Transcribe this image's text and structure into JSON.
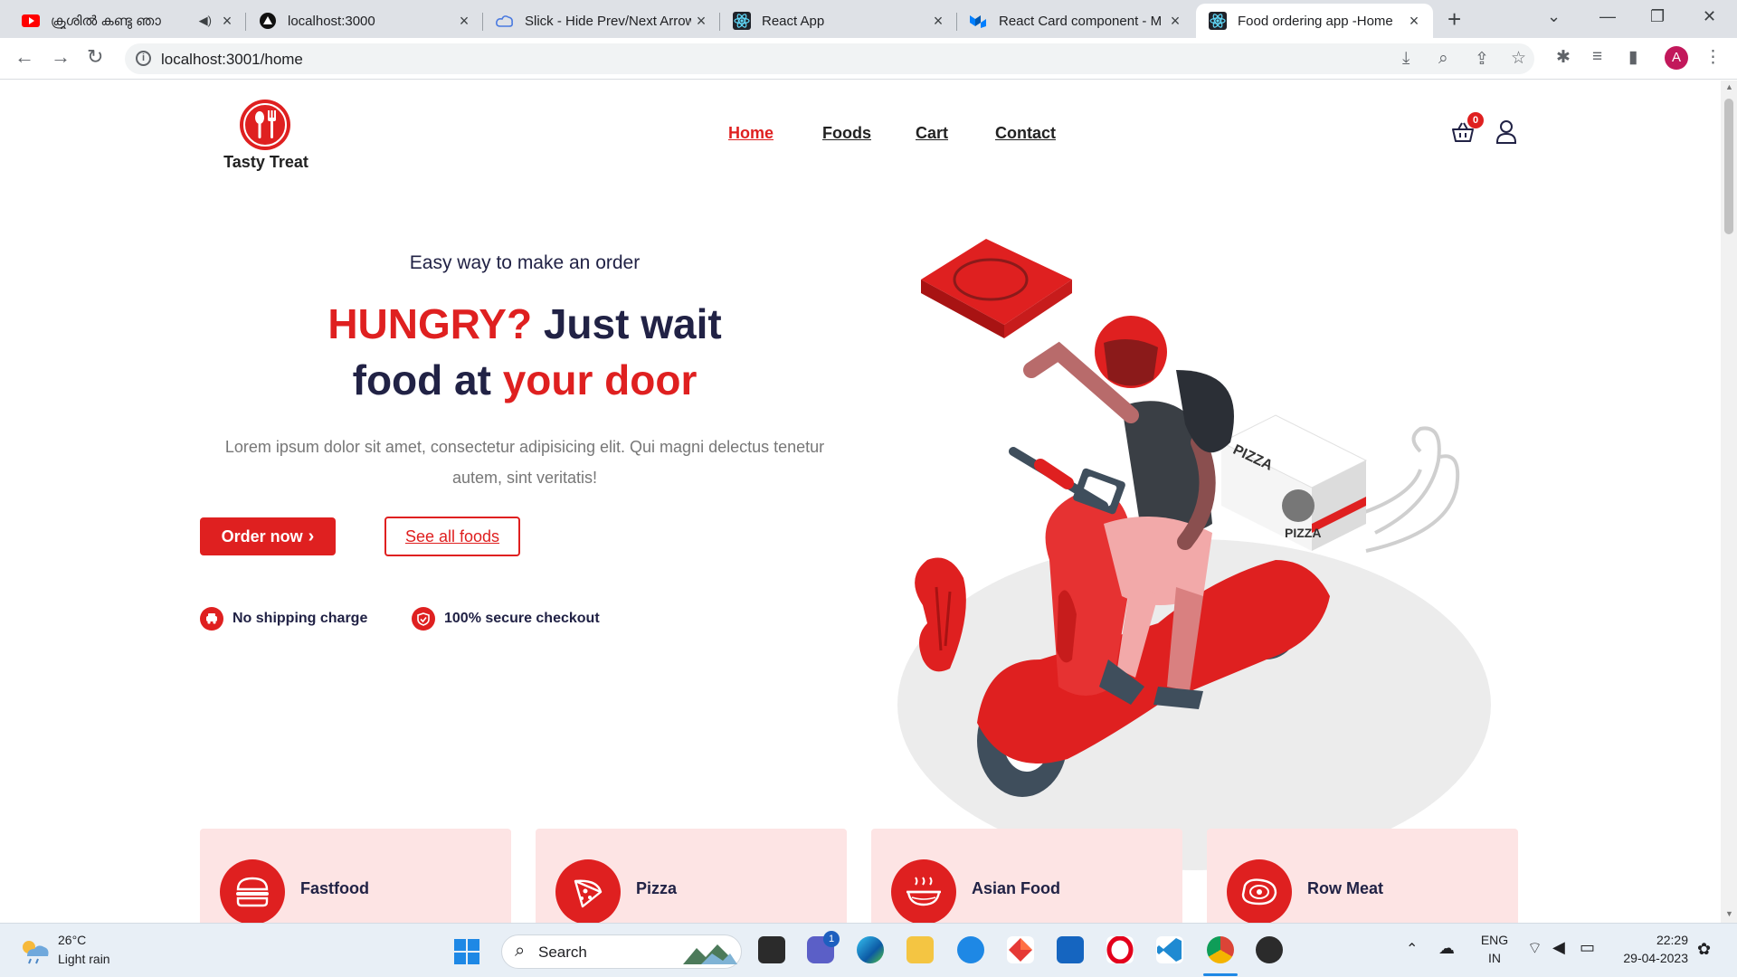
{
  "browser": {
    "tabs": [
      {
        "title": "ക്രൂശിൽ കണ്ടു ഞാ",
        "favicon": "youtube-icon"
      },
      {
        "title": "localhost:3000",
        "favicon": "vercel-icon"
      },
      {
        "title": "Slick - Hide Prev/Next Arrows",
        "favicon": "cloud-icon"
      },
      {
        "title": "React App",
        "favicon": "react-icon"
      },
      {
        "title": "React Card component - M",
        "favicon": "mui-icon"
      },
      {
        "title": "Food ordering app -Home",
        "favicon": "react-icon"
      }
    ],
    "url": "localhost:3001/home",
    "profile_initial": "A"
  },
  "header": {
    "brand": "Tasty Treat",
    "nav": [
      "Home",
      "Foods",
      "Cart",
      "Contact"
    ],
    "cart_count": "0"
  },
  "hero": {
    "subtitle": "Easy way to make an order",
    "title_part1": "HUNGRY?",
    "title_part2": " Just wait",
    "title_part3": "food at ",
    "title_part4": "your door",
    "text": "Lorem ipsum dolor sit amet, consectetur adipisicing elit. Qui magni delectus tenetur autem, sint veritatis!",
    "order_btn": "Order now",
    "order_btn_glyph": "›",
    "allfoods_btn": "See all foods",
    "features": [
      "No shipping charge",
      "100% secure checkout"
    ],
    "illustration_text": "PIZZA"
  },
  "categories": [
    {
      "label": "Fastfood",
      "icon": "burger-icon"
    },
    {
      "label": "Pizza",
      "icon": "pizza-icon"
    },
    {
      "label": "Asian Food",
      "icon": "asian-food-icon"
    },
    {
      "label": "Row Meat",
      "icon": "meat-icon"
    }
  ],
  "taskbar": {
    "weather_temp": "26°C",
    "weather_desc": "Light rain",
    "search": "Search",
    "teams_badge": "1",
    "lang1": "ENG",
    "lang2": "IN",
    "time": "22:29",
    "date": "29-04-2023"
  },
  "colors": {
    "accent": "#df2020",
    "category_bg": "#fde4e4",
    "text_dark": "#212245"
  }
}
